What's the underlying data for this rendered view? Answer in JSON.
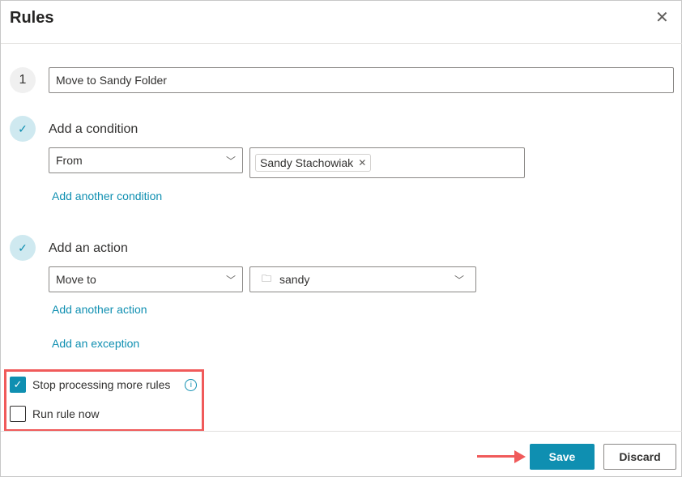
{
  "dialog": {
    "title": "Rules"
  },
  "rule": {
    "number": "1",
    "name": "Move to Sandy Folder"
  },
  "condition": {
    "heading": "Add a condition",
    "field": "From",
    "recipient": "Sandy Stachowiak",
    "add_link": "Add another condition"
  },
  "action": {
    "heading": "Add an action",
    "field": "Move to",
    "folder": "sandy",
    "add_link": "Add another action"
  },
  "exception": {
    "add_link": "Add an exception"
  },
  "options": {
    "stop_processing": {
      "label": "Stop processing more rules",
      "checked": true
    },
    "run_now": {
      "label": "Run rule now",
      "checked": false
    }
  },
  "footer": {
    "save": "Save",
    "discard": "Discard"
  },
  "colors": {
    "accent": "#0f8fb1",
    "highlight": "#f05a5a"
  }
}
